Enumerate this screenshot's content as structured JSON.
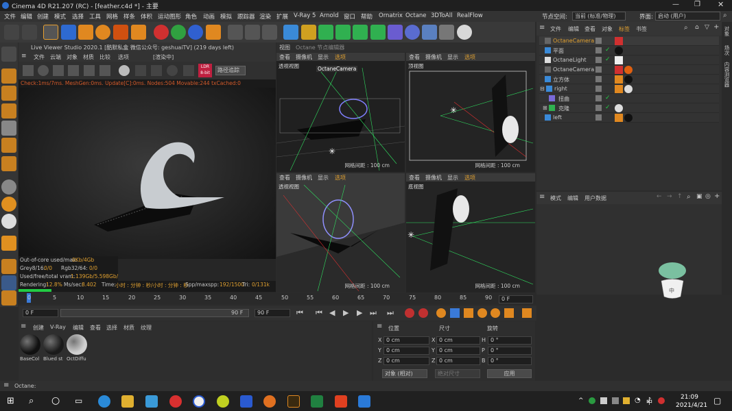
{
  "window": {
    "title": "Cinema 4D R21.207 (RC) - [feather.c4d *] - 主要"
  },
  "menu": [
    "文件",
    "编辑",
    "创建",
    "模式",
    "选择",
    "工具",
    "网格",
    "样条",
    "体积",
    "运动图形",
    "角色",
    "动画",
    "模拟",
    "跟踪器",
    "渲染",
    "扩展",
    "V-Ray 5",
    "Arnold",
    "窗口",
    "帮助",
    "Ornatrix",
    "Octane",
    "3DToAll",
    "RealFlow"
  ],
  "layout": {
    "node_space_label": "节点空间:",
    "node_space_value": "当前 (标准/物理)",
    "interface_label": "界面:",
    "interface_value": "启动 (用户)"
  },
  "live_viewer": {
    "title": "Live Viewer Studio 2020.1 [酷默私盒 微信公众号: geshuaiTV] (219 days left)",
    "menu": [
      "文件",
      "云端",
      "对象",
      "材质",
      "比较",
      "选项"
    ],
    "rendering_tag": "[渲染中]",
    "dropdown": "路径追踪",
    "ldr_label": "LDR 8-bit",
    "status": "Check:1ms/7ms. MeshGen:0ms. Update[C]:0ms. Nodes:504 Movable:244 txCached:0",
    "stats": {
      "out_of_core_label": "Out-of-core used/max:",
      "out_of_core": "0Kb/4Gb",
      "grey_label": "Grey8/16:",
      "grey": "0/0",
      "rgb_label": "Rgb32/64:",
      "rgb": "0/0",
      "vram_label": "Used/free/total vram:",
      "vram": "1.139Gb/5.598Gb/8G",
      "rendering_label": "Rendering:",
      "rendering": "12.8%",
      "ms_label": "Ms/sec:",
      "ms": "8.402",
      "time_label": "Time:",
      "time": "小时 : 分钟 : 秒/小时 : 分钟 : 秒",
      "spp_label": "Spp/maxspp:",
      "spp": "192/1500",
      "tri_label": "Tri:",
      "tri": "0/131k"
    },
    "progress": 0.128
  },
  "viewport_tabs": [
    "视图",
    "Octane 节点编辑器"
  ],
  "viewports": [
    {
      "menu": [
        "查看",
        "摄像机",
        "显示",
        "选项"
      ],
      "label": "透视视图",
      "camera": "OctaneCamera",
      "grid": "网格间距 : 100 cm"
    },
    {
      "menu": [
        "查看",
        "摄像机",
        "显示",
        "选项"
      ],
      "label": "顶视图",
      "grid": "网格间距 : 100 cm"
    },
    {
      "menu": [
        "查看",
        "摄像机",
        "显示",
        "选项"
      ],
      "label": "透视视图",
      "grid": "网格间距 : 100 cm"
    },
    {
      "menu": [
        "查看",
        "摄像机",
        "显示",
        "选项"
      ],
      "label": "底视图",
      "grid": "网格间距 : 100 cm"
    }
  ],
  "object_manager": {
    "menu": [
      "文件",
      "编辑",
      "查看",
      "对象",
      "标签",
      "书签"
    ],
    "objects": [
      {
        "name": "OctaneCamera",
        "highlight": true
      },
      {
        "name": "平面"
      },
      {
        "name": "OctaneLight"
      },
      {
        "name": "OctaneCamera"
      },
      {
        "name": "立方体"
      },
      {
        "name": "right"
      },
      {
        "name": "扭曲"
      },
      {
        "name": "克隆"
      },
      {
        "name": "left"
      }
    ]
  },
  "attributes": {
    "menu": [
      "模式",
      "编辑",
      "用户数据"
    ]
  },
  "side_tabs": [
    "对象",
    "场次",
    "内容浏览器"
  ],
  "timeline": {
    "ticks": [
      "0",
      "5",
      "10",
      "15",
      "20",
      "25",
      "30",
      "35",
      "40",
      "45",
      "50",
      "55",
      "60",
      "65",
      "70",
      "75",
      "80",
      "85",
      "90"
    ],
    "current": "0 F",
    "start": "0 F",
    "end1": "90 F",
    "end2": "90 F",
    "right_field": "0 F"
  },
  "materials": {
    "menu": [
      "创建",
      "V-Ray",
      "编辑",
      "查看",
      "选择",
      "材质",
      "纹理"
    ],
    "items": [
      {
        "name": "BaseCol",
        "color": "#111111"
      },
      {
        "name": "Blued st",
        "color": "#1a1a1a"
      },
      {
        "name": "OctDiffu",
        "color": "#d0d0d0"
      }
    ]
  },
  "coords": {
    "headers": [
      "位置",
      "尺寸",
      "旋转"
    ],
    "rows": [
      {
        "axis": "X",
        "pos": "0 cm",
        "size": "0 cm",
        "rot_label": "H",
        "rot": "0 °"
      },
      {
        "axis": "Y",
        "pos": "0 cm",
        "size": "0 cm",
        "rot_label": "P",
        "rot": "0 °"
      },
      {
        "axis": "Z",
        "pos": "0 cm",
        "size": "0 cm",
        "rot_label": "B",
        "rot": "0 °"
      }
    ],
    "mode": "对象 (相对)",
    "size_mode": "绝对尺寸",
    "apply": "应用"
  },
  "statusbar": "Octane:",
  "taskbar": {
    "time": "21:09",
    "date": "2021/4/21",
    "ime": "中"
  },
  "colors": {
    "accent": "#f0a030",
    "bg": "#2b2b2b",
    "panel": "#333333",
    "green": "#22cc44"
  }
}
